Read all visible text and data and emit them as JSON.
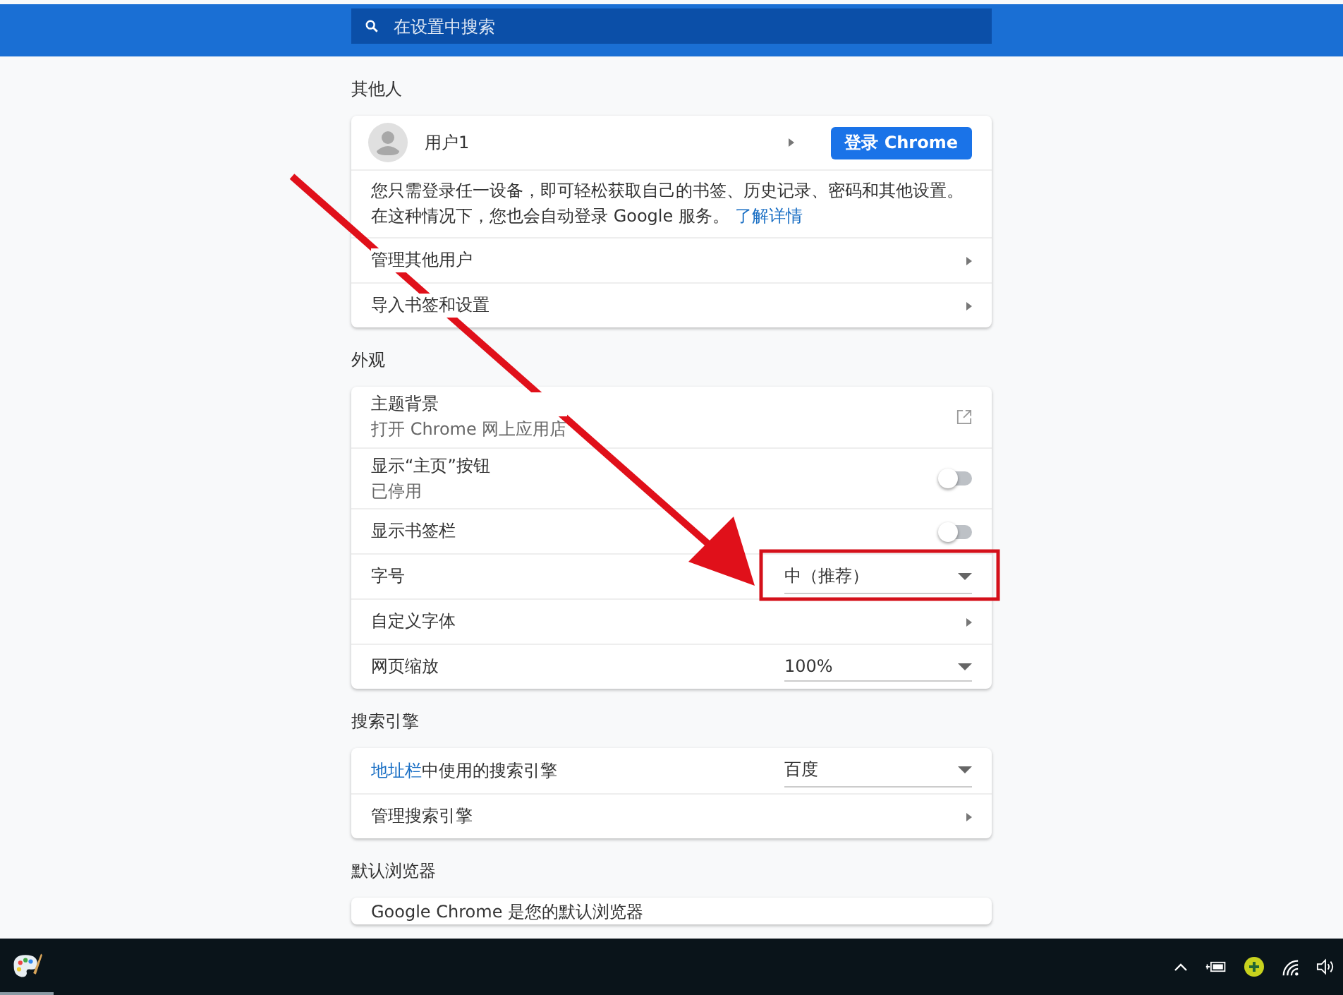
{
  "search": {
    "placeholder": "在设置中搜索"
  },
  "sections": [
    {
      "title": "其他人",
      "rows": [
        {
          "kind": "profile",
          "label": "用户1",
          "button": "登录 Chrome"
        },
        {
          "kind": "text",
          "text": "您只需登录任一设备，即可轻松获取自己的书签、历史记录、密码和其他设置。在这种情况下，您也会自动登录 Google 服务。",
          "link": "了解详情"
        },
        {
          "kind": "arrow",
          "label": "管理其他用户"
        },
        {
          "kind": "arrow",
          "label": "导入书签和设置"
        }
      ]
    },
    {
      "title": "外观",
      "rows": [
        {
          "kind": "external",
          "label": "主题背景",
          "sublabel": "打开 Chrome 网上应用店"
        },
        {
          "kind": "toggle",
          "label": "显示“主页”按钮",
          "sublabel": "已停用",
          "on": false
        },
        {
          "kind": "toggle",
          "label": "显示书签栏",
          "on": false
        },
        {
          "kind": "select",
          "label": "字号",
          "value": "中（推荐）"
        },
        {
          "kind": "arrow",
          "label": "自定义字体"
        },
        {
          "kind": "select",
          "label": "网页缩放",
          "value": "100%"
        }
      ]
    },
    {
      "title": "搜索引擎",
      "rows": [
        {
          "kind": "select",
          "link": "地址栏",
          "label": "中使用的搜索引擎",
          "value": "百度"
        },
        {
          "kind": "arrow",
          "label": "管理搜索引擎"
        }
      ]
    },
    {
      "title": "默认浏览器",
      "rows": [
        {
          "kind": "plain",
          "label": "Google Chrome 是您的默认浏览器"
        }
      ]
    }
  ]
}
